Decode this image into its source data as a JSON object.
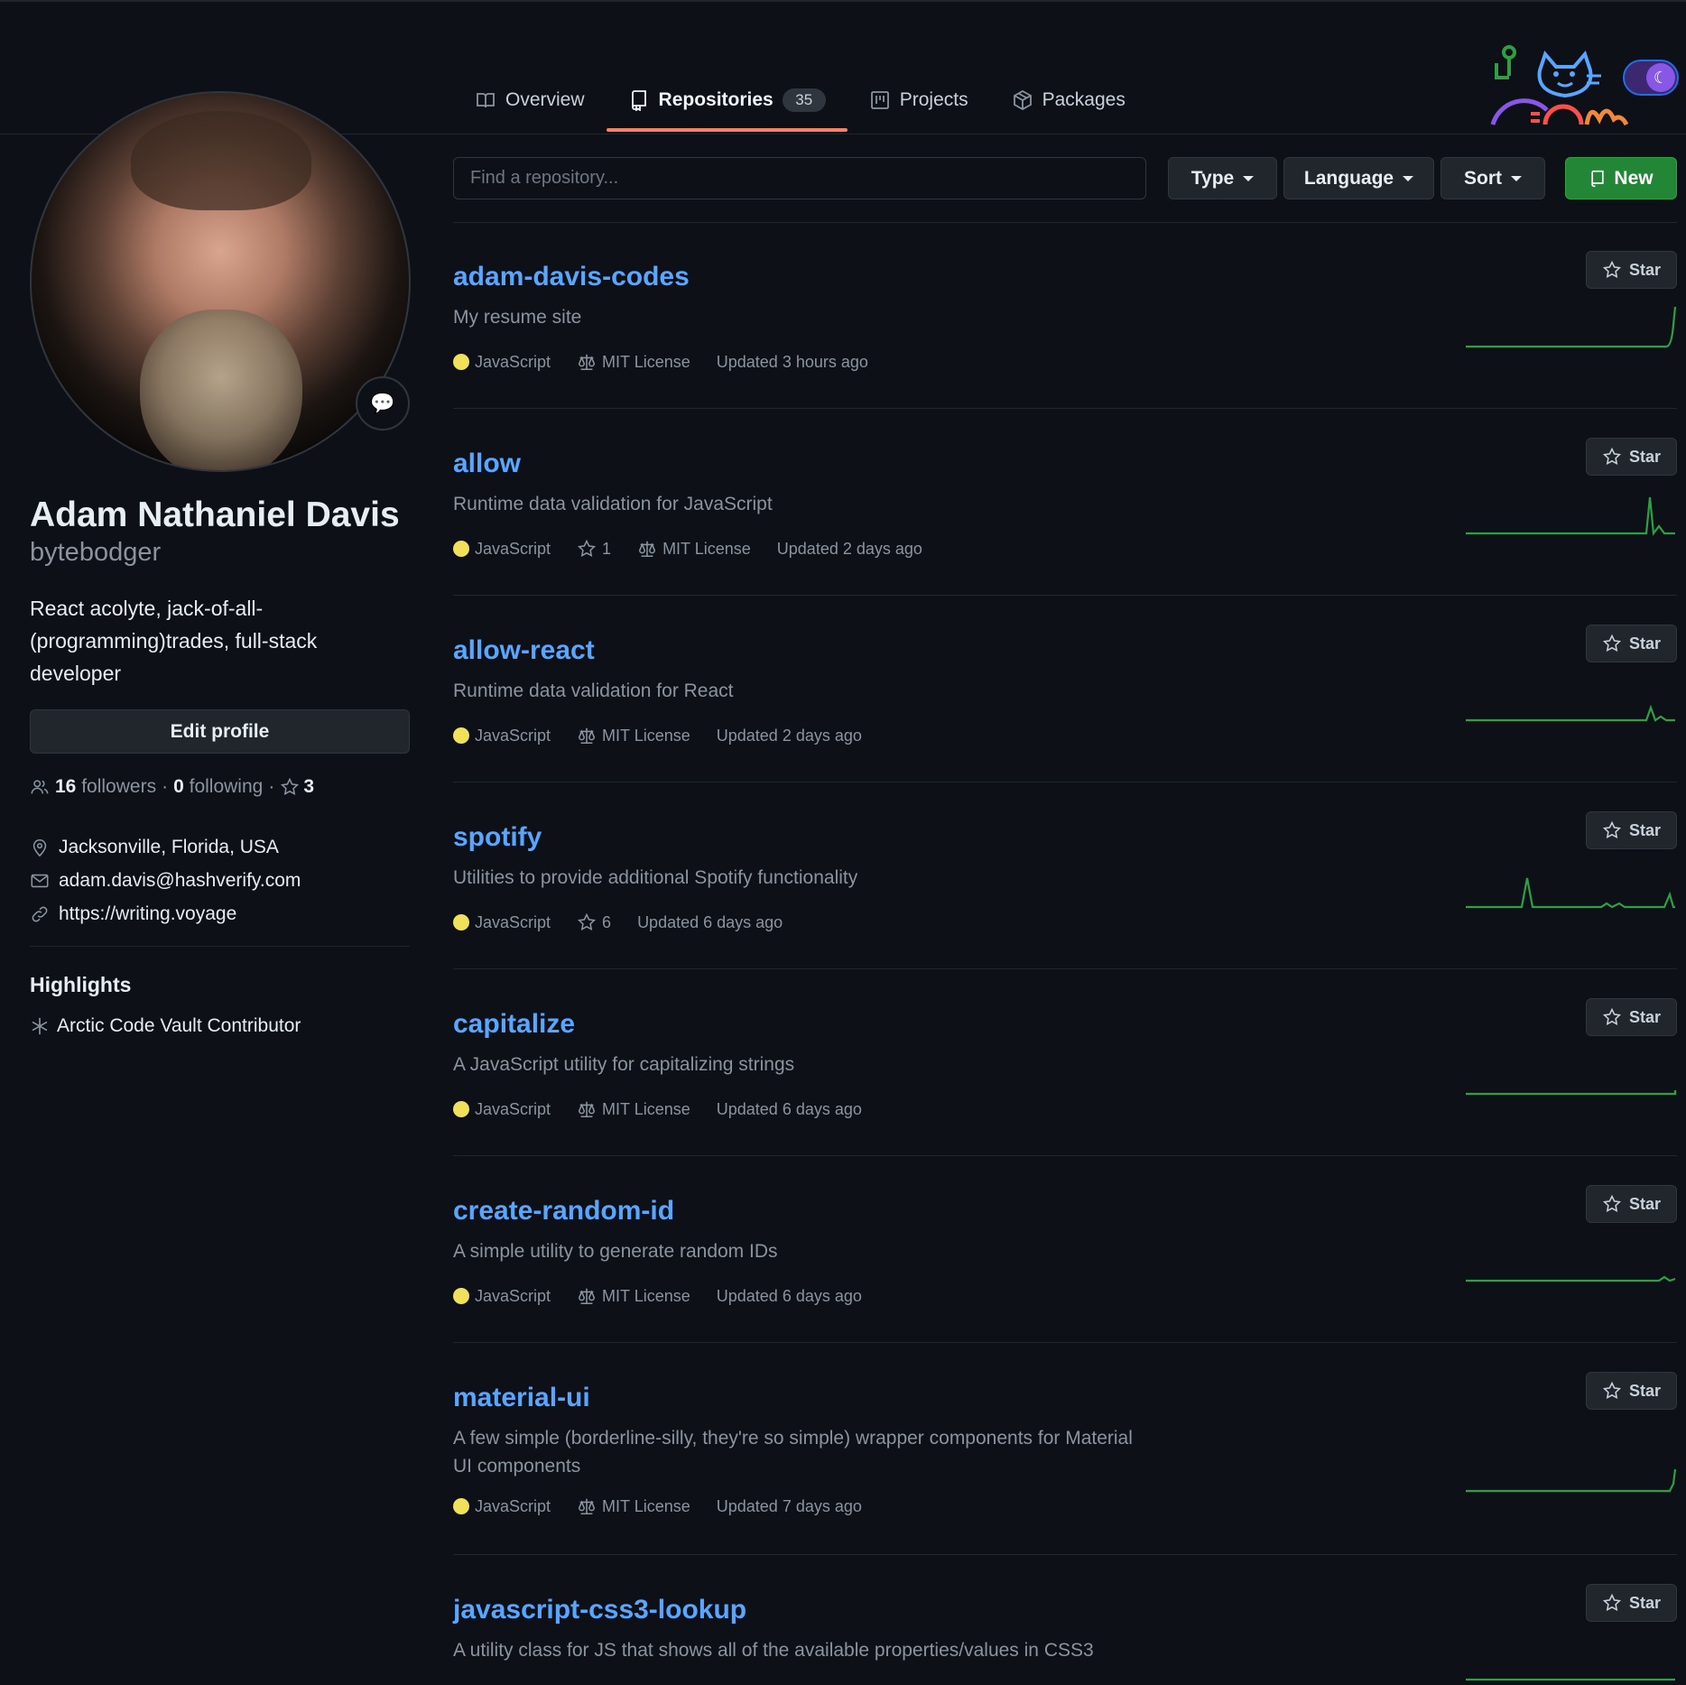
{
  "tabs": [
    {
      "label": "Overview",
      "icon": "book-icon"
    },
    {
      "label": "Repositories",
      "icon": "repo-icon",
      "count": "35",
      "active": true
    },
    {
      "label": "Projects",
      "icon": "project-icon"
    },
    {
      "label": "Packages",
      "icon": "package-icon"
    }
  ],
  "profile": {
    "fullname": "Adam Nathaniel Davis",
    "login": "bytebodger",
    "bio": "React acolyte, jack-of-all-(programming)trades, full-stack developer",
    "edit_label": "Edit profile",
    "followers_count": "16",
    "followers_label": "followers",
    "dot": "·",
    "following_count": "0",
    "following_label": "following",
    "stars_count": "3",
    "location": "Jacksonville, Florida, USA",
    "email": "adam.davis@hashverify.com",
    "website": "https://writing.voyage",
    "highlights_title": "Highlights",
    "highlight_item": "Arctic Code Vault Contributor"
  },
  "filters": {
    "search_placeholder": "Find a repository...",
    "type_label": "Type",
    "language_label": "Language",
    "sort_label": "Sort",
    "new_label": "New"
  },
  "star_label": "Star",
  "colors": {
    "javascript": "#f1e05a",
    "accent": "#f78166",
    "link": "#58a6ff",
    "new_button": "#238636"
  },
  "repos": [
    {
      "name": "adam-davis-codes",
      "desc": "My resume site",
      "lang": "JavaScript",
      "stars": "",
      "license": "MIT License",
      "updated": "Updated 3 hours ago"
    },
    {
      "name": "allow",
      "desc": "Runtime data validation for JavaScript",
      "lang": "JavaScript",
      "stars": "1",
      "license": "MIT License",
      "updated": "Updated 2 days ago"
    },
    {
      "name": "allow-react",
      "desc": "Runtime data validation for React",
      "lang": "JavaScript",
      "stars": "",
      "license": "MIT License",
      "updated": "Updated 2 days ago"
    },
    {
      "name": "spotify",
      "desc": "Utilities to provide additional Spotify functionality",
      "lang": "JavaScript",
      "stars": "6",
      "license": "",
      "updated": "Updated 6 days ago"
    },
    {
      "name": "capitalize",
      "desc": "A JavaScript utility for capitalizing strings",
      "lang": "JavaScript",
      "stars": "",
      "license": "MIT License",
      "updated": "Updated 6 days ago"
    },
    {
      "name": "create-random-id",
      "desc": "A simple utility to generate random IDs",
      "lang": "JavaScript",
      "stars": "",
      "license": "MIT License",
      "updated": "Updated 6 days ago"
    },
    {
      "name": "material-ui",
      "desc": "A few simple (borderline-silly, they're so simple) wrapper components for Material UI components",
      "lang": "JavaScript",
      "stars": "",
      "license": "MIT License",
      "updated": "Updated 7 days ago"
    },
    {
      "name": "javascript-css3-lookup",
      "desc": "A utility class for JS that shows all of the available properties/values in CSS3",
      "lang": "",
      "stars": "",
      "license": "",
      "updated": ""
    }
  ]
}
